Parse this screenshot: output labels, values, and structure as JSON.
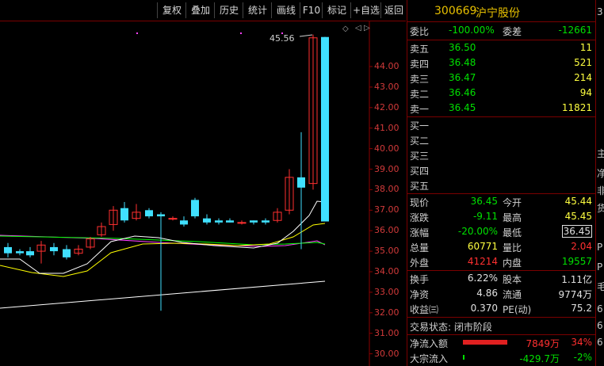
{
  "toolbar": {
    "items": [
      "复权",
      "叠加",
      "历史",
      "统计",
      "画线",
      "F10",
      "标记",
      "+自选",
      "返回"
    ]
  },
  "chart": {
    "price_marker": "45.56",
    "y_labels": [
      "44.00",
      "43.00",
      "42.00",
      "41.00",
      "40.00",
      "39.00",
      "38.00",
      "37.00",
      "36.00",
      "35.00",
      "34.00",
      "33.00",
      "32.00",
      "31.00",
      "30.00"
    ],
    "colors": {
      "up": "#ff3030",
      "down": "#40e0ff",
      "grid": "#8b0000",
      "ma5": "#ffffff",
      "ma10": "#ffff00",
      "ma20": "#ff40ff",
      "ma60": "#00ff00",
      "ma_long": "#ffffff"
    }
  },
  "panel": {
    "code": "300669",
    "name": "沪宁股份",
    "weibi": {
      "label": "委比",
      "value": "-100.00%",
      "label2": "委差",
      "value2": "-12661"
    },
    "sell": [
      {
        "label": "卖五",
        "price": "36.50",
        "vol": "11"
      },
      {
        "label": "卖四",
        "price": "36.48",
        "vol": "521"
      },
      {
        "label": "卖三",
        "price": "36.47",
        "vol": "214"
      },
      {
        "label": "卖二",
        "price": "36.46",
        "vol": "94"
      },
      {
        "label": "卖一",
        "price": "36.45",
        "vol": "11821"
      }
    ],
    "buy": [
      {
        "label": "买一"
      },
      {
        "label": "买二"
      },
      {
        "label": "买三"
      },
      {
        "label": "买四"
      },
      {
        "label": "买五"
      }
    ],
    "stats": [
      {
        "l1": "现价",
        "v1": "36.45",
        "l2": "今开",
        "v2": "45.44"
      },
      {
        "l1": "涨跌",
        "v1": "-9.11",
        "l2": "最高",
        "v2": "45.45"
      },
      {
        "l1": "涨幅",
        "v1": "-20.00%",
        "l2": "最低",
        "v2": "36.45"
      },
      {
        "l1": "总量",
        "v1": "60771",
        "l2": "量比",
        "v2": "2.04"
      },
      {
        "l1": "外盘",
        "v1": "41214",
        "l2": "内盘",
        "v2": "19557"
      }
    ],
    "stats2": [
      {
        "l1": "换手",
        "v1": "6.22%",
        "l2": "股本",
        "v2": "1.11亿"
      },
      {
        "l1": "净资",
        "v1": "4.86",
        "l2": "流通",
        "v2": "9774万"
      },
      {
        "l1": "收益㈢",
        "v1": "0.370",
        "l2": "PE(动)",
        "v2": "75.2"
      }
    ],
    "trade_state": "交易状态: 闭市阶段",
    "net_inflow": {
      "label": "净流入额",
      "value": "7849万",
      "pct": "34%"
    },
    "block_inflow": {
      "label": "大宗流入",
      "value": "-429.7万",
      "pct": "-2%"
    }
  },
  "sliver": [
    "3",
    "主",
    "净",
    "非",
    "货",
    "P",
    "P",
    "毛",
    "6",
    "6",
    "6"
  ]
}
